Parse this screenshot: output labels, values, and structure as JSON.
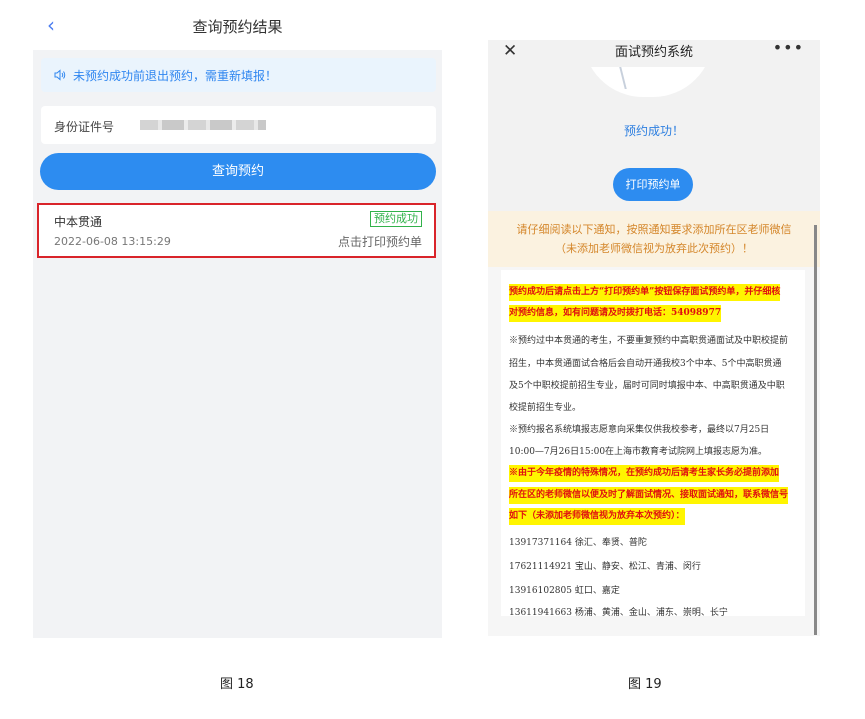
{
  "left_screen": {
    "title": "查询预约结果",
    "notice": "未预约成功前退出预约，需重新填报！",
    "id_label": "身份证件号",
    "query_button": "查询预约",
    "result": {
      "name": "中本贯通",
      "badge": "预约成功",
      "time": "2022-06-08 13:15:29",
      "print_link": "点击打印预约单"
    }
  },
  "right_screen": {
    "title": "面试预约系统",
    "success": "预约成功！",
    "print_button": "打印预约单",
    "warn_line1": "请仔细阅读以下通知，按照通知要求添加所在区老师微信",
    "warn_line2": "（未添加老师微信视为放弃此次预约）！",
    "doc": {
      "hl1a": "预约成功后请点击上方“打印预约单”按钮保存面试预约单，并仔细核",
      "hl1b": "对预约信息，如有问题请及时拨打电话：54098977",
      "p1a": "※预约过中本贯通的考生，不要重复预约中高职贯通面试及中职校提前",
      "p1b": "招生，中本贯通面试合格后会自动开通我校3个中本、5个中高职贯通",
      "p1c": "及5个中职校提前招生专业，届时可同时填报中本、中高职贯通及中职",
      "p1d": "校提前招生专业。",
      "p2a": "※预约报名系统填报志愿意向采集仅供我校参考，最终以7月25日",
      "p2b": "10:00—7月26日15:00在上海市教育考试院网上填报志愿为准。",
      "hl2a": "※由于今年疫情的特殊情况，在预约成功后请考生家长务必提前添加",
      "hl2b": "所在区的老师微信以便及时了解面试情况、接取面试通知，联系微信号",
      "hl2c": "如下（未添加老师微信视为放弃本次预约）：",
      "c1": "13917371164 徐汇、奉贤、普陀",
      "c2": "17621114921 宝山、静安、松江、青浦、闵行",
      "c3": "13916102805 虹口、嘉定",
      "c4": "13611941663 杨浦、黄浦、金山、浦东、崇明、长宁"
    }
  },
  "captions": {
    "left": "图 18",
    "right": "图 19"
  },
  "colors": {
    "primary_blue": "#2d8cf0",
    "success_green": "#31b24a",
    "highlight_red_border": "#d9242a",
    "warn_orange": "#d4862a",
    "highlight_yellow": "#fff500"
  }
}
